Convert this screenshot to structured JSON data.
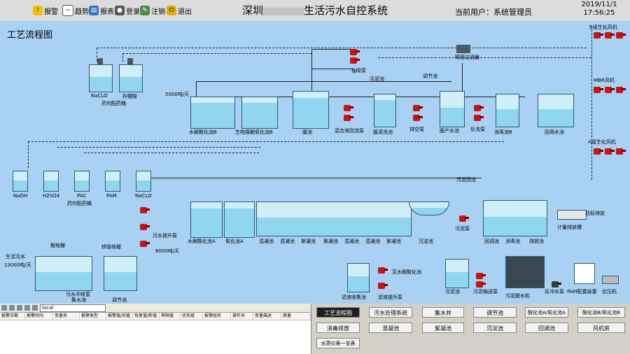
{
  "toolbar": {
    "alarm": "报警",
    "trend": "趋势",
    "report": "报表",
    "login": "登录",
    "logout": "注销",
    "exit": "退出"
  },
  "header": {
    "title_left": "深圳",
    "title_right": "生活污水自控系统",
    "user_label": "当前用户：系统管理员",
    "date": "2019/11/1",
    "time": "17:56:25"
  },
  "process": {
    "page_title": "工艺流程图",
    "labels": {
      "naclo_top": "NaCLO",
      "citric": "柠檬酸",
      "dosing_room_top": "药剂配药桶",
      "flow_5000": "5000吨/天",
      "hydrolysis_b": "水解酸化池B",
      "biofilm_b": "生物接触氧化池B",
      "membrane": "膜池",
      "suction_pump": "抽吸泵",
      "sludge_pool": "污泥池",
      "mix_return_pump": "混合液回流泵",
      "membrane_clean": "膜清洗池",
      "vacuum_pump": "排空泵",
      "regulating_pool": "调节池",
      "membrane_product": "膜产水池",
      "backwash_pump": "反洗泵",
      "fine_filter": "精密过滤器",
      "disinfect_b": "消毒池B",
      "reuse_pool": "回用水池",
      "fan_b": "B组生化风机",
      "fan_mbr": "MBR风机",
      "fan_a": "A组生化风机",
      "naoh": "NaOH",
      "h2so4": "H2SO4",
      "pac": "PAC",
      "pam": "PAM",
      "naclo_mid": "NaCLO",
      "dosing_room_mid": "药剂配药桶",
      "sludge_return": "污泥回流",
      "inflow": "生活污水",
      "inflow_rate": "13000吨/天",
      "coarse_screen": "粗格栅",
      "fine_screen": "转鼓格栅",
      "transfer_pump": "污水中转泵",
      "collect_pool": "集水池",
      "lift_pump": "污水提升泵",
      "adjust_pool": "调节池",
      "flow_8000": "8000吨/天",
      "hydrolysis_a": "水解酸化池A",
      "oxidation_a": "氧化池A",
      "coag1": "混凝池",
      "coag2": "混凝池",
      "floc1": "絮凝池",
      "floc2": "絮凝池",
      "coag3": "混凝池",
      "coag4": "混凝池",
      "floc3": "絮凝池",
      "sediment": "沉淀池",
      "sludge_pump_mid": "污泥泵",
      "regulate2": "回调池",
      "disinfect": "消毒池",
      "discharge": "排放池",
      "standard_discharge": "达标排放",
      "meter_tank": "计量排放槽",
      "filtrate_pool": "滤液收集池",
      "to_hydrolysis": "至水解酸化池",
      "filtrate_pump": "滤液提升泵",
      "sludge_pool2": "污泥池",
      "sludge_feed": "污泥输送泵",
      "dewater": "污泥脱水机",
      "backwash_pump2": "反冲水泵",
      "pam_device": "PAM配置装置",
      "air_comp": "空压机"
    }
  },
  "alarm_panel": {
    "dropdown": "local",
    "columns": [
      "报警日期",
      "报警时间",
      "变量名",
      "报警类型",
      "报警值/旧值",
      "恢复值/新值",
      "界限值",
      "优先级",
      "报警组名",
      "操作员",
      "变量描述",
      "质量"
    ]
  },
  "nav": {
    "process": "工艺流程图",
    "sewage": "污水处理系统",
    "collect": "集水井",
    "adjust": "调节池",
    "acid_a": "酸化池A/氧化池A",
    "acid_b": "酸化池B/氧化池B",
    "disinfect_out": "消毒排放",
    "coag": "混凝池",
    "floc": "絮凝池",
    "sed": "沉淀池",
    "reg": "回调池",
    "fan": "风机房",
    "instrument": "水质仪表一览表"
  },
  "colors": {
    "canvas": "#a8d1f3",
    "pump": "#c81414",
    "water": "#8fd6ee"
  }
}
